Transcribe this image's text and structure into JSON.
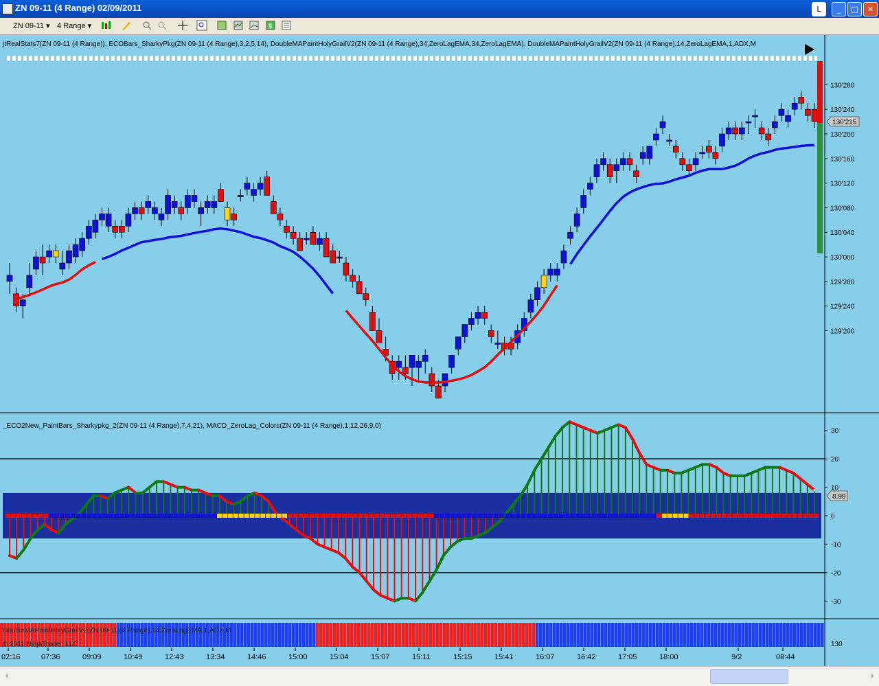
{
  "window": {
    "title": "ZN 09-11  (4 Range)  02/09/2011",
    "restore_label": "L"
  },
  "toolbar": {
    "instrument": "ZN 09-11",
    "period": "4 Range"
  },
  "price_panel": {
    "label": "jtRealStats7(ZN 09-11  (4 Range)), ECOBars_SharkyPkg(ZN 09-11  (4 Range),3,2,5,14), DoubleMAPaintHolyGrailV2(ZN 09-11  (4 Range),34,ZeroLagEMA,34,ZeroLagEMA), DoubleMAPaintHolyGrailV2(ZN 09-11  (4 Range),14,ZeroLagEMA,1,ADX,M",
    "y_ticks": [
      "130'280",
      "130'240",
      "130'200",
      "130'160",
      "130'120",
      "130'080",
      "130'040",
      "130'000",
      "129'280",
      "129'240",
      "129'200"
    ],
    "last_price": "130'215"
  },
  "osc_panel": {
    "label": "_ECO2New_PaintBars_Sharkypkg_2(ZN 09-11 (4 Range),7,4,21), MACD_ZeroLag_Colors(ZN 09-11 (4 Range),1,12,26,9,0)",
    "y_ticks": [
      "30",
      "20",
      "10",
      "0",
      "-10",
      "-20",
      "-30"
    ],
    "last_value": "8.99"
  },
  "holygrail_panel": {
    "label": "DoubleMAPaintHolyGrailV2(ZN 09-11  (4 Range),14,ZeroLagEMA,1,ADX,M",
    "copyright": "© 2011 NinjaTrader, LLC",
    "y_tick": "130"
  },
  "time_axis": [
    "02:16",
    "07:36",
    "09:09",
    "10:49",
    "12:43",
    "13:34",
    "14:46",
    "15:00",
    "15:04",
    "15:07",
    "15:11",
    "15:15",
    "15:41",
    "16:07",
    "16:42",
    "17:05",
    "18:00",
    "9/2",
    "08:44"
  ],
  "colors": {
    "bg": "#87ceeb",
    "up": "#1010d8",
    "down": "#e01010",
    "doji": "#ffd21a",
    "green": "#0a7a14",
    "navy": "#1c2fa0"
  },
  "chart_data": {
    "type": "candlestick",
    "price_units": "decimal",
    "candles": [
      [
        129.96,
        129.99,
        129.94,
        129.97
      ],
      [
        129.94,
        129.95,
        129.91,
        129.92
      ],
      [
        129.92,
        129.94,
        129.9,
        129.93
      ],
      [
        129.95,
        129.99,
        129.94,
        129.97
      ],
      [
        129.98,
        130.01,
        129.97,
        130.0
      ],
      [
        130.0,
        130.02,
        129.97,
        129.99
      ],
      [
        130.0,
        130.02,
        129.99,
        130.01
      ],
      [
        130.0,
        130.02,
        129.99,
        130.01
      ],
      [
        129.98,
        130.01,
        129.97,
        129.99
      ],
      [
        129.99,
        130.02,
        129.98,
        130.01
      ],
      [
        130.0,
        130.03,
        129.99,
        130.02
      ],
      [
        130.01,
        130.04,
        130.0,
        130.03
      ],
      [
        130.03,
        130.06,
        130.02,
        130.05
      ],
      [
        130.04,
        130.07,
        130.03,
        130.06
      ],
      [
        130.06,
        130.08,
        130.05,
        130.07
      ],
      [
        130.05,
        130.08,
        130.04,
        130.07
      ],
      [
        130.05,
        130.06,
        130.03,
        130.04
      ],
      [
        130.05,
        130.06,
        130.03,
        130.04
      ],
      [
        130.05,
        130.08,
        130.04,
        130.07
      ],
      [
        130.07,
        130.09,
        130.06,
        130.08
      ],
      [
        130.08,
        130.09,
        130.06,
        130.07
      ],
      [
        130.08,
        130.1,
        130.07,
        130.09
      ],
      [
        130.07,
        130.09,
        130.06,
        130.08
      ],
      [
        130.06,
        130.08,
        130.05,
        130.07
      ],
      [
        130.07,
        130.11,
        130.06,
        130.1
      ],
      [
        130.08,
        130.1,
        130.07,
        130.09
      ],
      [
        130.08,
        130.09,
        130.06,
        130.07
      ],
      [
        130.08,
        130.11,
        130.07,
        130.1
      ],
      [
        130.09,
        130.11,
        130.08,
        130.1
      ],
      [
        130.07,
        130.09,
        130.05,
        130.08
      ],
      [
        130.08,
        130.1,
        130.07,
        130.09
      ],
      [
        130.08,
        130.1,
        130.07,
        130.09
      ],
      [
        130.11,
        130.12,
        130.09,
        130.09
      ],
      [
        130.08,
        130.09,
        130.05,
        130.06
      ],
      [
        130.07,
        130.08,
        130.05,
        130.06
      ],
      [
        130.1,
        130.11,
        130.09,
        130.1
      ],
      [
        130.11,
        130.13,
        130.1,
        130.12
      ],
      [
        130.1,
        130.12,
        130.09,
        130.11
      ],
      [
        130.11,
        130.13,
        130.1,
        130.12
      ],
      [
        130.13,
        130.14,
        130.1,
        130.1
      ],
      [
        130.09,
        130.1,
        130.07,
        130.07
      ],
      [
        130.07,
        130.08,
        130.05,
        130.06
      ],
      [
        130.05,
        130.06,
        130.03,
        130.04
      ],
      [
        130.04,
        130.05,
        130.02,
        130.03
      ],
      [
        130.03,
        130.04,
        130.01,
        130.01
      ],
      [
        130.03,
        130.04,
        130.02,
        130.03
      ],
      [
        130.04,
        130.05,
        130.02,
        130.02
      ],
      [
        130.02,
        130.04,
        130.01,
        130.03
      ],
      [
        130.03,
        130.04,
        130.0,
        130.0
      ],
      [
        130.01,
        130.02,
        129.99,
        129.99
      ],
      [
        130.0,
        130.01,
        129.99,
        130.0
      ],
      [
        129.99,
        130.0,
        129.96,
        129.97
      ],
      [
        129.97,
        129.98,
        129.95,
        129.96
      ],
      [
        129.96,
        129.97,
        129.94,
        129.94
      ],
      [
        129.94,
        129.95,
        129.92,
        129.93
      ],
      [
        129.91,
        129.92,
        129.88,
        129.88
      ],
      [
        129.88,
        129.9,
        129.86,
        129.86
      ],
      [
        129.85,
        129.87,
        129.83,
        129.84
      ],
      [
        129.83,
        129.84,
        129.8,
        129.81
      ],
      [
        129.82,
        129.84,
        129.8,
        129.83
      ],
      [
        129.82,
        129.84,
        129.8,
        129.81
      ],
      [
        129.82,
        129.84,
        129.79,
        129.84
      ],
      [
        129.82,
        129.84,
        129.8,
        129.83
      ],
      [
        129.83,
        129.85,
        129.81,
        129.84
      ],
      [
        129.81,
        129.82,
        129.78,
        129.79
      ],
      [
        129.79,
        129.8,
        129.77,
        129.77
      ],
      [
        129.79,
        129.81,
        129.78,
        129.81
      ],
      [
        129.82,
        129.84,
        129.81,
        129.84
      ],
      [
        129.85,
        129.87,
        129.84,
        129.87
      ],
      [
        129.87,
        129.89,
        129.86,
        129.89
      ],
      [
        129.89,
        129.91,
        129.88,
        129.9
      ],
      [
        129.9,
        129.92,
        129.89,
        129.91
      ],
      [
        129.91,
        129.92,
        129.89,
        129.9
      ],
      [
        129.88,
        129.89,
        129.86,
        129.87
      ],
      [
        129.86,
        129.88,
        129.85,
        129.86
      ],
      [
        129.86,
        129.87,
        129.84,
        129.85
      ],
      [
        129.86,
        129.87,
        129.84,
        129.85
      ],
      [
        129.86,
        129.89,
        129.85,
        129.88
      ],
      [
        129.88,
        129.91,
        129.87,
        129.9
      ],
      [
        129.91,
        129.94,
        129.9,
        129.93
      ],
      [
        129.93,
        129.96,
        129.92,
        129.95
      ],
      [
        129.95,
        129.98,
        129.94,
        129.97
      ],
      [
        129.97,
        129.99,
        129.96,
        129.98
      ],
      [
        129.97,
        129.99,
        129.96,
        129.98
      ],
      [
        129.99,
        130.02,
        129.98,
        130.01
      ],
      [
        130.03,
        130.05,
        130.02,
        130.04
      ],
      [
        130.05,
        130.08,
        130.04,
        130.07
      ],
      [
        130.08,
        130.11,
        130.07,
        130.1
      ],
      [
        130.11,
        130.13,
        130.1,
        130.12
      ],
      [
        130.13,
        130.16,
        130.12,
        130.15
      ],
      [
        130.15,
        130.17,
        130.14,
        130.16
      ],
      [
        130.15,
        130.16,
        130.12,
        130.13
      ],
      [
        130.14,
        130.16,
        130.12,
        130.15
      ],
      [
        130.15,
        130.17,
        130.14,
        130.16
      ],
      [
        130.16,
        130.17,
        130.14,
        130.15
      ],
      [
        130.14,
        130.15,
        130.12,
        130.13
      ],
      [
        130.16,
        130.18,
        130.15,
        130.17
      ],
      [
        130.16,
        130.18,
        130.15,
        130.18
      ],
      [
        130.19,
        130.21,
        130.18,
        130.2
      ],
      [
        130.21,
        130.23,
        130.2,
        130.22
      ],
      [
        130.19,
        130.2,
        130.18,
        130.19
      ],
      [
        130.18,
        130.19,
        130.16,
        130.17
      ],
      [
        130.16,
        130.17,
        130.14,
        130.15
      ],
      [
        130.15,
        130.16,
        130.13,
        130.14
      ],
      [
        130.15,
        130.17,
        130.14,
        130.16
      ],
      [
        130.17,
        130.18,
        130.16,
        130.17
      ],
      [
        130.18,
        130.19,
        130.16,
        130.17
      ],
      [
        130.17,
        130.18,
        130.15,
        130.16
      ],
      [
        130.18,
        130.21,
        130.17,
        130.2
      ],
      [
        130.2,
        130.22,
        130.19,
        130.21
      ],
      [
        130.21,
        130.22,
        130.19,
        130.2
      ],
      [
        130.2,
        130.22,
        130.19,
        130.21
      ],
      [
        130.22,
        130.23,
        130.2,
        130.22
      ],
      [
        130.23,
        130.24,
        130.21,
        130.23
      ],
      [
        130.21,
        130.22,
        130.19,
        130.2
      ],
      [
        130.2,
        130.21,
        130.18,
        130.19
      ],
      [
        130.21,
        130.23,
        130.2,
        130.22
      ],
      [
        130.23,
        130.25,
        130.22,
        130.24
      ],
      [
        130.22,
        130.24,
        130.21,
        130.23
      ],
      [
        130.24,
        130.26,
        130.23,
        130.25
      ],
      [
        130.26,
        130.27,
        130.24,
        130.25
      ],
      [
        130.24,
        130.25,
        130.22,
        130.23
      ],
      [
        130.24,
        130.25,
        130.21,
        130.22
      ]
    ],
    "osc_values": [
      -14,
      -15,
      -12,
      -8,
      -5,
      -3,
      -5,
      -6,
      -3,
      -1,
      1,
      4,
      7,
      7,
      6,
      8,
      9,
      10,
      8,
      8,
      10,
      12,
      12,
      11,
      10,
      10,
      9,
      9,
      8,
      7,
      7,
      5,
      4,
      5,
      7,
      8,
      7,
      5,
      1,
      -1,
      -3,
      -5,
      -7,
      -8,
      -10,
      -11,
      -12,
      -13,
      -15,
      -18,
      -20,
      -23,
      -26,
      -28,
      -29,
      -30,
      -29,
      -29,
      -30,
      -27,
      -23,
      -19,
      -14,
      -11,
      -9,
      -8,
      -8,
      -7,
      -6,
      -4,
      -2,
      1,
      4,
      7,
      11,
      16,
      20,
      24,
      28,
      31,
      33,
      32,
      31,
      30,
      29,
      30,
      31,
      32,
      31,
      27,
      22,
      18,
      17,
      16,
      16,
      15,
      15,
      16,
      17,
      18,
      18,
      17,
      15,
      14,
      14,
      14,
      15,
      16,
      17,
      17,
      17,
      16,
      15,
      13,
      11,
      9
    ],
    "osc_ylim": [
      -35,
      35
    ],
    "price_ylim": [
      129.78,
      130.305
    ],
    "ma_segments": [
      {
        "color": "red",
        "start": 1,
        "end": 13
      },
      {
        "color": "blue",
        "start": 14,
        "end": 49
      },
      {
        "color": "red",
        "start": 51,
        "end": 83
      },
      {
        "color": "blue",
        "start": 85,
        "end": 130
      }
    ],
    "grid": false,
    "legend": "none"
  }
}
